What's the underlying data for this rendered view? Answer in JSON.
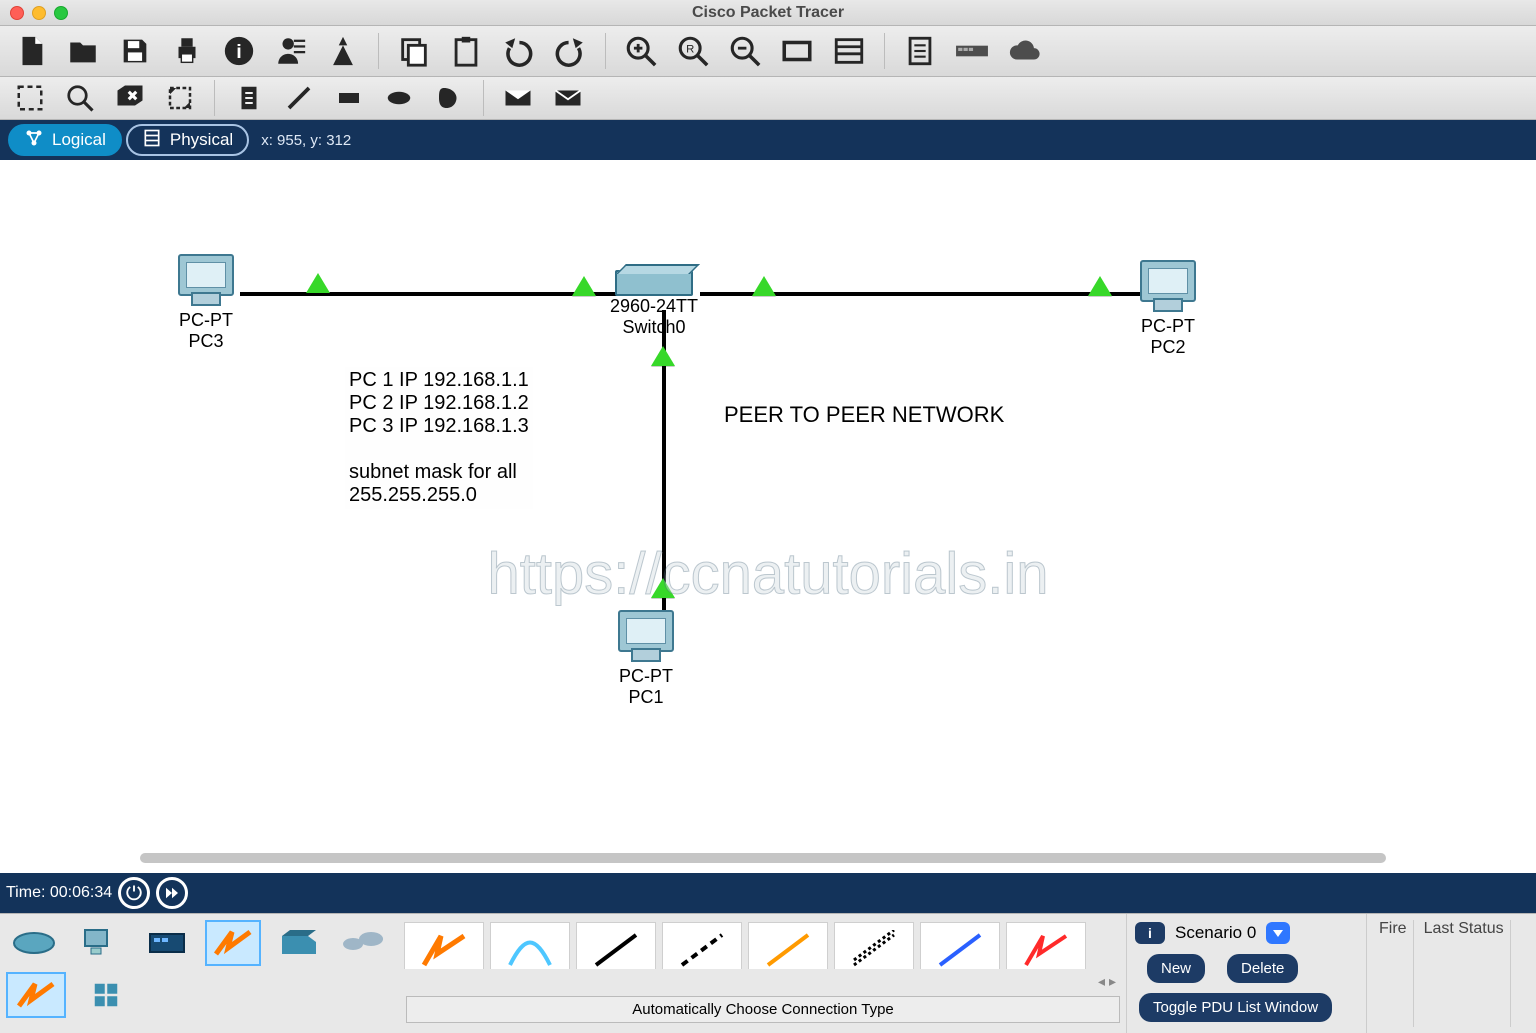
{
  "window": {
    "title": "Cisco Packet Tracer"
  },
  "tabs": {
    "logical": "Logical",
    "physical": "Physical"
  },
  "coords": "x: 955, y: 312",
  "canvas": {
    "devices": {
      "switch": {
        "line1": "2960-24TT",
        "line2": "Switch0"
      },
      "pc1": {
        "line1": "PC-PT",
        "line2": "PC1"
      },
      "pc2": {
        "line1": "PC-PT",
        "line2": "PC2"
      },
      "pc3": {
        "line1": "PC-PT",
        "line2": "PC3"
      }
    },
    "note_ip": "PC 1 IP 192.168.1.1\nPC 2 IP 192.168.1.2\nPC 3 IP 192.168.1.3\n\nsubnet mask for all\n255.255.255.0",
    "note_title": "PEER TO PEER NETWORK",
    "watermark": "https://ccnatutorials.in"
  },
  "timebar": {
    "label": "Time: 00:06:34"
  },
  "scenario": {
    "name": "Scenario 0",
    "new": "New",
    "delete": "Delete",
    "toggle": "Toggle PDU List Window"
  },
  "palette": {
    "caption": "Automatically Choose Connection Type",
    "results_headers": {
      "fire": "Fire",
      "last": "Last Status"
    }
  }
}
